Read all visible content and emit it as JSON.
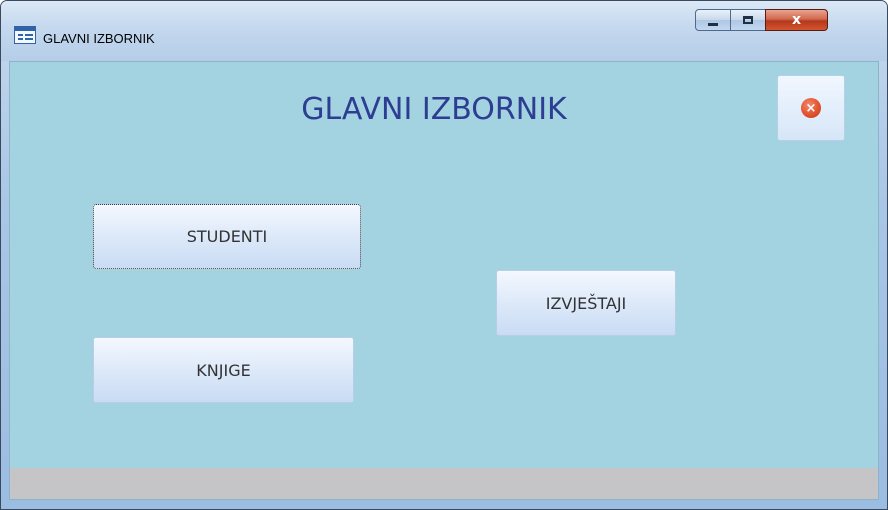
{
  "window": {
    "title": "GLAVNI IZBORNIK",
    "app_icon": "form-icon",
    "controls": {
      "minimize_icon": "minimize-icon",
      "maximize_icon": "maximize-icon",
      "close_icon": "close-icon",
      "close_label": "x"
    }
  },
  "form": {
    "heading": "GLAVNI IZBORNIK",
    "close_button_icon": "close-circle-icon",
    "close_button_glyph": "×",
    "buttons": {
      "studenti": "STUDENTI",
      "izvjestaji": "IZVJEŠTAJI",
      "knjige": "KNJIGE"
    },
    "colors": {
      "background": "#a3d3e0",
      "heading": "#2d3d92",
      "footer": "#c5c5c7"
    }
  }
}
